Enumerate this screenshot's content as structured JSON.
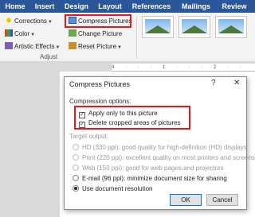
{
  "ribbon": {
    "tabs": [
      {
        "label": "Home",
        "active": false
      },
      {
        "label": "Insert",
        "active": false
      },
      {
        "label": "Design",
        "active": false
      },
      {
        "label": "Layout",
        "active": false
      },
      {
        "label": "References",
        "active": false
      },
      {
        "label": "Mailings",
        "active": false
      },
      {
        "label": "Review",
        "active": false
      }
    ],
    "adjust": {
      "corrections": "Corrections",
      "color": "Color",
      "artistic_effects": "Artistic Effects",
      "compress_pictures": "Compress Pictures",
      "change_picture": "Change Picture",
      "reset_picture": "Reset Picture",
      "group_label": "Adjust"
    },
    "accent_color": "#2b579a",
    "highlight_color": "#e81818"
  },
  "ruler_text": "4 · · · 1 · · · 2 · · ·",
  "dialog": {
    "title": "Compress Pictures",
    "help": "?",
    "close": "✕",
    "compression_options_label": "Compression options:",
    "apply_only": {
      "label": "Apply only to this picture",
      "checked": true
    },
    "delete_cropped": {
      "label": "Delete cropped areas of pictures",
      "checked": true
    },
    "target_output_label": "Target output:",
    "targets": [
      {
        "label": "HD (330 ppi): good quality for high-definition (HD) displays",
        "enabled": false,
        "selected": false
      },
      {
        "label": "Print (220 ppi): excellent quality on most printers and screens",
        "enabled": false,
        "selected": false
      },
      {
        "label": "Web (150 ppi): good for web pages and projectors",
        "enabled": false,
        "selected": false
      },
      {
        "label": "E-mail (96 ppi): minimize document size for sharing",
        "enabled": true,
        "selected": false
      },
      {
        "label": "Use document resolution",
        "enabled": true,
        "selected": true
      }
    ],
    "ok_label": "OK",
    "cancel_label": "Cancel"
  }
}
